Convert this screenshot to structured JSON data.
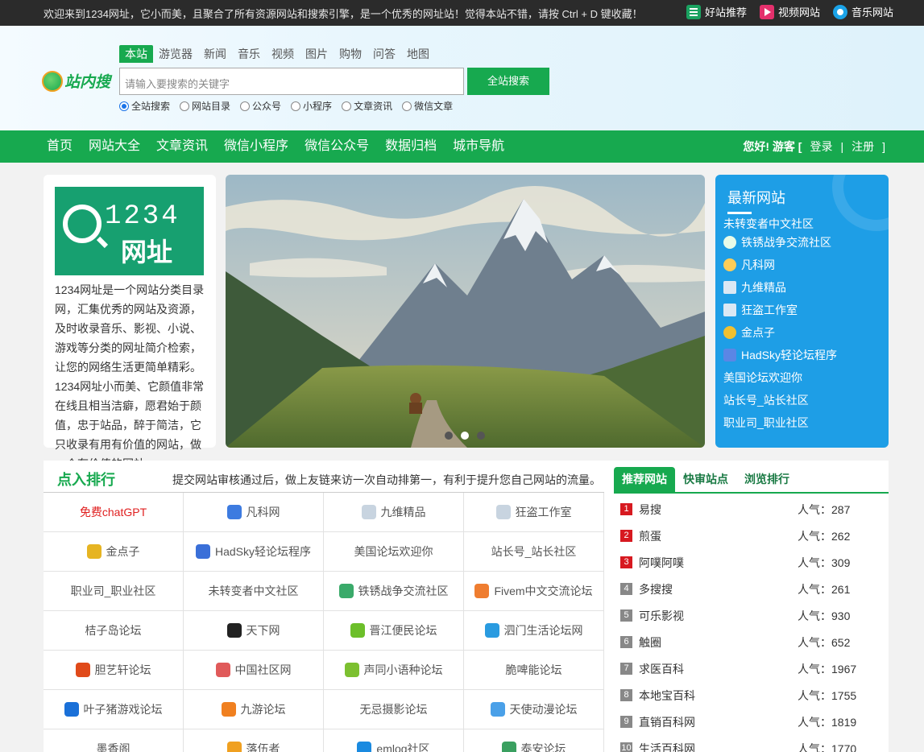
{
  "topbar": {
    "welcome": "欢迎来到1234网址，它小而美，且聚合了所有资源网站和搜索引擎，是一个优秀的网址站！觉得本站不错，请按 Ctrl + D 键收藏！",
    "links": [
      {
        "label": "好站推荐",
        "icon": "grid-icon"
      },
      {
        "label": "视频网站",
        "icon": "play-icon"
      },
      {
        "label": "音乐网站",
        "icon": "music-icon"
      }
    ]
  },
  "search": {
    "logo_text": "站内搜",
    "tabs": [
      "本站",
      "游览器",
      "新闻",
      "音乐",
      "视频",
      "图片",
      "购物",
      "问答",
      "地图"
    ],
    "placeholder": "请输入要搜索的关键字",
    "button": "全站搜索",
    "options": [
      "全站搜索",
      "网站目录",
      "公众号",
      "小程序",
      "文章资讯",
      "微信文章"
    ]
  },
  "nav": {
    "items": [
      "首页",
      "网站大全",
      "文章资讯",
      "微信小程序",
      "微信公众号",
      "数据归档",
      "城市导航"
    ],
    "greeting": "您好!",
    "guest": "游客 [",
    "login": "登录",
    "sep": "|",
    "register": "注册",
    "close": "]"
  },
  "intro": {
    "logo_num": "1234",
    "logo_word": "网址",
    "text": "1234网址是一个网站分类目录网，汇集优秀的网站及资源，及时收录音乐、影视、小说、游戏等分类的网址简介检索，让您的网络生活更简单精彩。1234网址小而美、它颜值非常在线且相当洁癖，愿君始于颜值，忠于站品，醉于简洁，它只收录有用有价值的网站，做一个有价值的网站。"
  },
  "newest": {
    "title": "最新网站",
    "items": [
      "未转变者中文社区",
      "铁锈战争交流社区",
      "凡科网",
      "九维精品",
      "狂盗工作室",
      "金点子",
      "HadSky轻论坛程序",
      "美国论坛欢迎你",
      "站长号_站长社区",
      "职业司_职业社区"
    ]
  },
  "rank": {
    "title": "点入排行",
    "desc": "提交网站审核通过后，做上友链来访一次自动排第一，有利于提升您自己网站的流量。",
    "cells": [
      "免费chatGPT",
      "凡科网",
      "九维精品",
      "狂盗工作室",
      "金点子",
      "HadSky轻论坛程序",
      "美国论坛欢迎你",
      "站长号_站长社区",
      "职业司_职业社区",
      "未转变者中文社区",
      "铁锈战争交流社区",
      "Fivem中文交流论坛",
      "桔子岛论坛",
      "天下网",
      "晋江便民论坛",
      "泗门生活论坛网",
      "胆艺轩论坛",
      "中国社区网",
      "声同小语种论坛",
      "脆啤能论坛",
      "叶子猪游戏论坛",
      "九游论坛",
      "无忌摄影论坛",
      "天使动漫论坛",
      "墨香阁",
      "落伍者",
      "emlog社区",
      "泰安论坛"
    ]
  },
  "side": {
    "tabs": [
      "推荐网站",
      "快审站点",
      "浏览排行"
    ],
    "pop_label": "人气：",
    "items": [
      {
        "n": "1",
        "name": "易搜",
        "pop": "287"
      },
      {
        "n": "2",
        "name": "煎蛋",
        "pop": "262"
      },
      {
        "n": "3",
        "name": "阿噗阿噗",
        "pop": "309"
      },
      {
        "n": "4",
        "name": "多搜搜",
        "pop": "261"
      },
      {
        "n": "5",
        "name": "可乐影视",
        "pop": "930"
      },
      {
        "n": "6",
        "name": "触圈",
        "pop": "652"
      },
      {
        "n": "7",
        "name": "求医百科",
        "pop": "1967"
      },
      {
        "n": "8",
        "name": "本地宝百科",
        "pop": "1755"
      },
      {
        "n": "9",
        "name": "直销百科网",
        "pop": "1819"
      },
      {
        "n": "10",
        "name": "生活百科网",
        "pop": "1770"
      }
    ]
  }
}
